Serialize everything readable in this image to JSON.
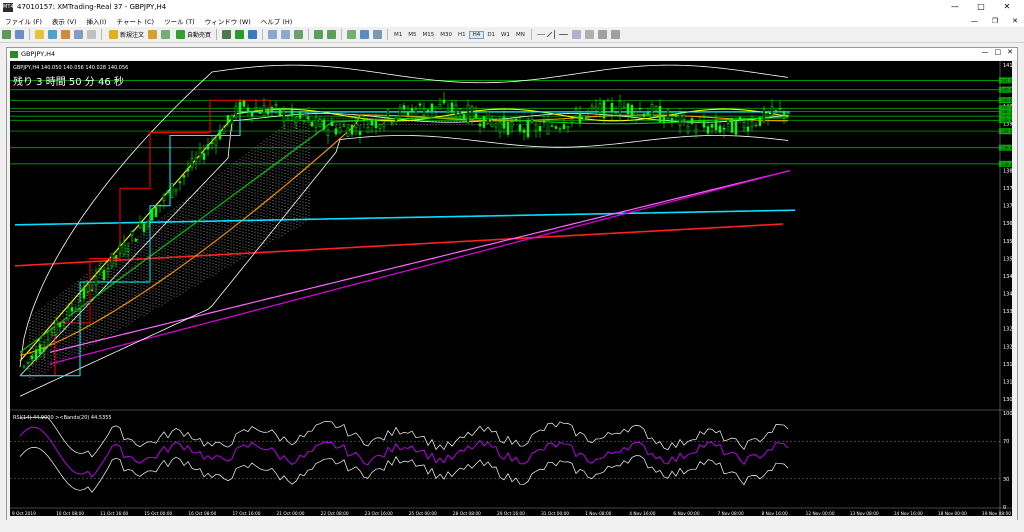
{
  "window": {
    "title": "47010157: XMTrading-Real 37 - GBPJPY,H4",
    "icon_label": "MT4"
  },
  "menu": [
    "ファイル (F)",
    "表示 (V)",
    "挿入(I)",
    "チャート (C)",
    "ツール (T)",
    "ウィンドウ (W)",
    "ヘルプ (H)"
  ],
  "toolbar": {
    "new_order": "新規注文",
    "auto_trade": "自動売買",
    "timeframes": [
      "M1",
      "M5",
      "M15",
      "M30",
      "H1",
      "H4",
      "D1",
      "W1",
      "MN"
    ],
    "active_tf": "H4"
  },
  "chart_window": {
    "title": "GBPJPY,H4"
  },
  "chart": {
    "info": "GBPJPY,H4  140.050 140.056 140.028 140.056",
    "countdown": "残り 3 時間 50 分 46 秒",
    "price_ticks": [
      "141.805",
      "141.005",
      "140.405",
      "139.805",
      "139.005",
      "138.205",
      "137.605",
      "137.005",
      "136.405",
      "135.805",
      "135.205",
      "134.605",
      "134.005",
      "133.405",
      "132.805",
      "132.205",
      "131.605",
      "131.005",
      "130.405"
    ],
    "price_boxes": [
      "141.279",
      "140.962",
      "140.604",
      "140.331",
      "140.216",
      "140.056",
      "139.925",
      "139.545",
      "138.982",
      "138.432"
    ],
    "date_labels": [
      "9 Oct 2019",
      "10 Oct 08:00",
      "11 Oct 16:00",
      "15 Oct 00:00",
      "16 Oct 08:00",
      "17 Oct 16:00",
      "21 Oct 00:00",
      "22 Oct 08:00",
      "23 Oct 16:00",
      "25 Oct 00:00",
      "28 Oct 08:00",
      "29 Oct 16:00",
      "31 Oct 00:00",
      "1 Nov 08:00",
      "4 Nov 16:00",
      "6 Nov 00:00",
      "7 Nov 08:00",
      "8 Nov 16:00",
      "12 Nov 00:00",
      "13 Nov 08:00",
      "14 Nov 16:00",
      "18 Nov 00:00",
      "19 Nov 08:00"
    ],
    "indicator": {
      "label": "RSI(14) 44.9000  ><Bands(20) 44.5355",
      "levels": [
        "100",
        "70",
        "30",
        "0"
      ]
    },
    "colors": {
      "bg": "#000000",
      "candle": "#00ff00",
      "grid_line": "#00c800",
      "bb": "#ffffff",
      "tenkan": "#ff0000",
      "kijun": "#00ffff",
      "ema_short": "#ffff00",
      "ema_mid": "#ff9900",
      "ema_green": "#00d000",
      "ma_long_cyan": "#00e0ff",
      "ma_long_red": "#ff2020",
      "ma_violet": "#ff66ff",
      "ma_magenta": "#e000e0",
      "rsi": "#c800ff"
    }
  }
}
